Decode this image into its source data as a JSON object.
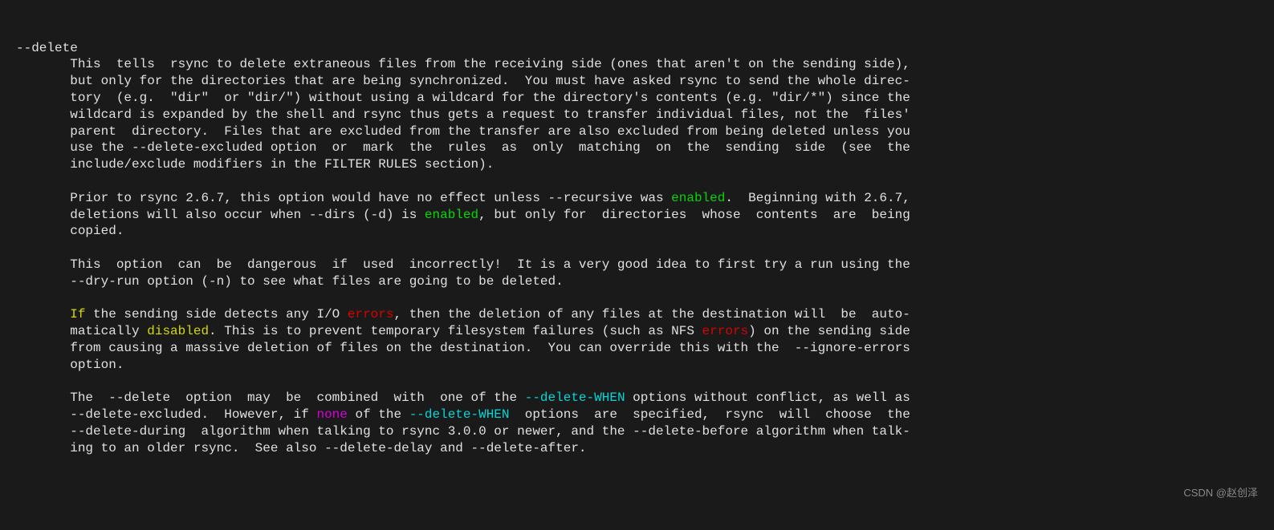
{
  "option_name": "--delete",
  "para1": {
    "line1": "This  tells  rsync to delete extraneous files from the receiving side (ones that aren't on the sending side),",
    "line2": "but only for the directories that are being synchronized.  You must have asked rsync to send the whole direc-",
    "line3": "tory  (e.g.  \"dir\"  or \"dir/\") without using a wildcard for the directory's contents (e.g. \"dir/*\") since the",
    "line4": "wildcard is expanded by the shell and rsync thus gets a request to transfer individual files, not the  files'",
    "line5": "parent  directory.  Files that are excluded from the transfer are also excluded from being deleted unless you",
    "line6": "use the --delete-excluded option  or  mark  the  rules  as  only  matching  on  the  sending  side  (see  the",
    "line7": "include/exclude modifiers in the FILTER RULES section)."
  },
  "para2": {
    "line1_a": "Prior to rsync 2.6.7, this option would have no effect unless --recursive was ",
    "enabled1": "enabled",
    "line1_b": ".  Beginning with 2.6.7,",
    "line2_a": "deletions will also occur when --dirs (-d) is ",
    "enabled2": "enabled",
    "line2_b": ", but only for  directories  whose  contents  are  being",
    "line3": "copied."
  },
  "para3": {
    "line1": "This  option  can  be  dangerous  if  used  incorrectly!  It is a very good idea to first try a run using the",
    "line2": "--dry-run option (-n) to see what files are going to be deleted."
  },
  "para4": {
    "if": "If",
    "line1_a": " the sending side detects any I/O ",
    "errors1": "errors",
    "line1_b": ", then the deletion of any files at the destination will  be  auto-",
    "line2_a": "matically ",
    "disabled": "disabled",
    "line2_b": ". This is to prevent temporary filesystem failures (such as NFS ",
    "errors2": "errors",
    "line2_c": ") on the sending side",
    "line3": "from causing a massive deletion of files on the destination.  You can override this with the  --ignore-errors",
    "line4": "option."
  },
  "para5": {
    "line1_a": "The  --delete  option  may  be  combined  with  one of the ",
    "dw1": "--delete-WHEN",
    "line1_b": " options without conflict, as well as",
    "line2_a": "--delete-excluded.  However, if ",
    "none": "none",
    "line2_b": " of the ",
    "dw2": "--delete-WHEN",
    "line2_c": "  options  are  specified,  rsync  will  choose  the",
    "line3": "--delete-during  algorithm when talking to rsync 3.0.0 or newer, and the --delete-before algorithm when talk-",
    "line4": "ing to an older rsync.  See also --delete-delay and --delete-after."
  },
  "watermark": "CSDN @赵创泽"
}
